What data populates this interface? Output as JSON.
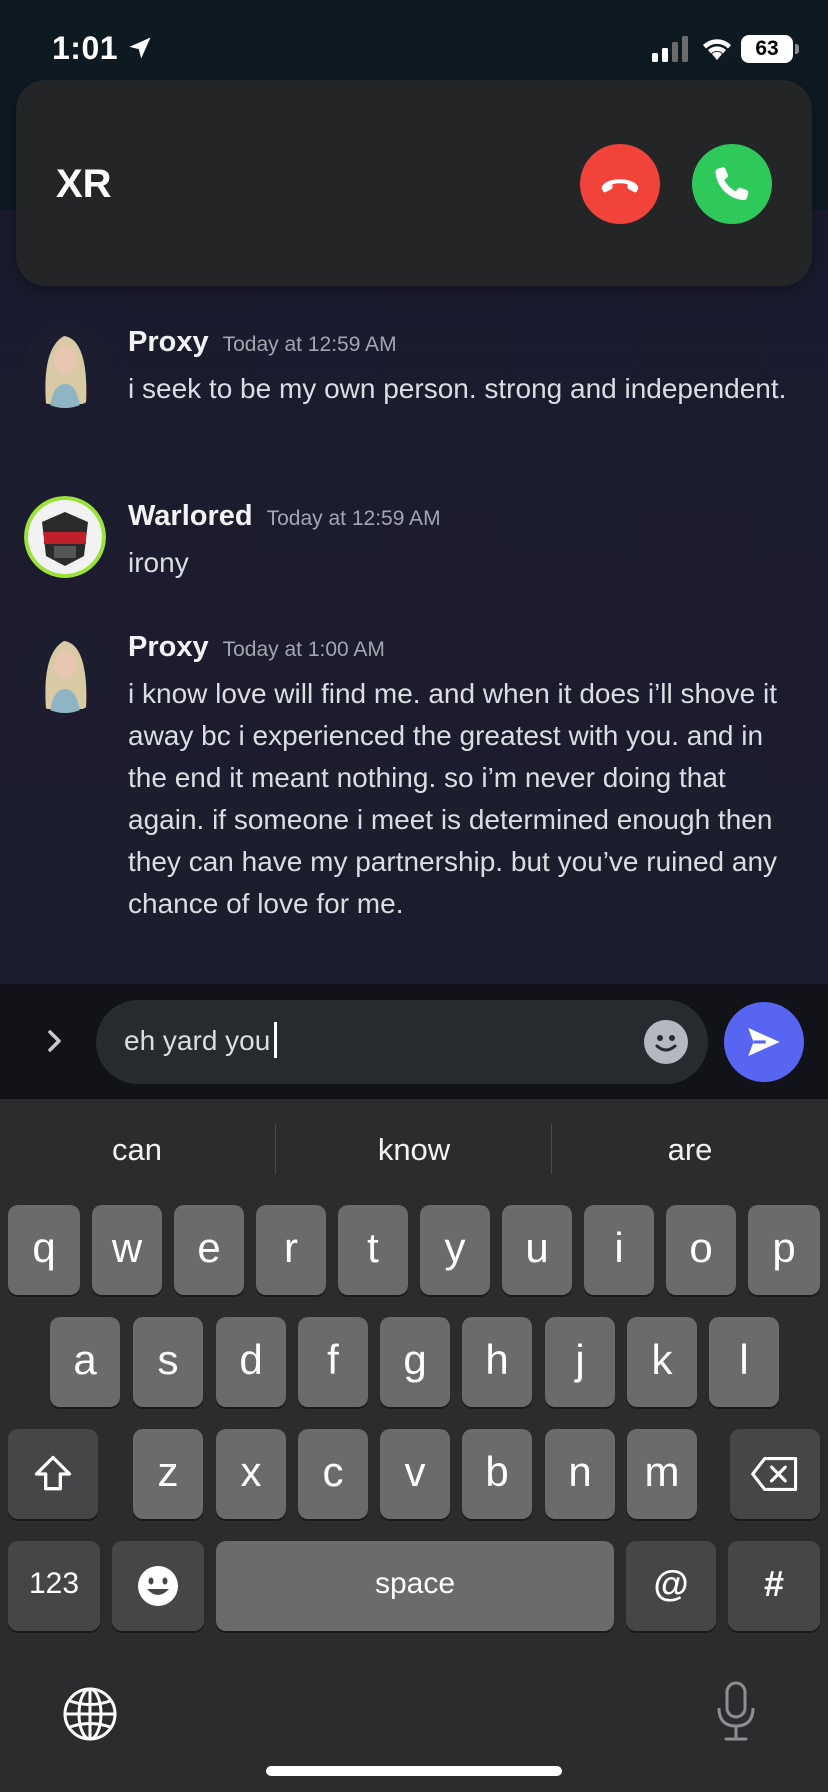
{
  "status_bar": {
    "time": "1:01",
    "battery": "63"
  },
  "incoming_call": {
    "caller": "XR"
  },
  "messages": [
    {
      "author": "Proxy",
      "timestamp": "Today at 12:59 AM",
      "text": "i seek to be my own person. strong and independent."
    },
    {
      "author": "Warlored",
      "timestamp": "Today at 12:59 AM",
      "text": "irony"
    },
    {
      "author": "Proxy",
      "timestamp": "Today at 1:00 AM",
      "text": "i know love will find me. and when it does i’ll shove it away bc i experienced the greatest with you. and in the end it meant nothing. so i’m never doing that again. if someone i meet is determined enough then they can have my partnership. but you’ve ruined any chance of love for me."
    }
  ],
  "composer": {
    "value": "eh yard you"
  },
  "keyboard": {
    "suggestions": [
      "can",
      "know",
      "are"
    ],
    "row1": [
      "q",
      "w",
      "e",
      "r",
      "t",
      "y",
      "u",
      "i",
      "o",
      "p"
    ],
    "row2": [
      "a",
      "s",
      "d",
      "f",
      "g",
      "h",
      "j",
      "k",
      "l"
    ],
    "row3": [
      "z",
      "x",
      "c",
      "v",
      "b",
      "n",
      "m"
    ],
    "numbers_key": "123",
    "space_key": "space",
    "at_key": "@",
    "hash_key": "#"
  },
  "colors": {
    "decline": "#f2433b",
    "accept": "#2ec95a",
    "send": "#5865f2"
  }
}
